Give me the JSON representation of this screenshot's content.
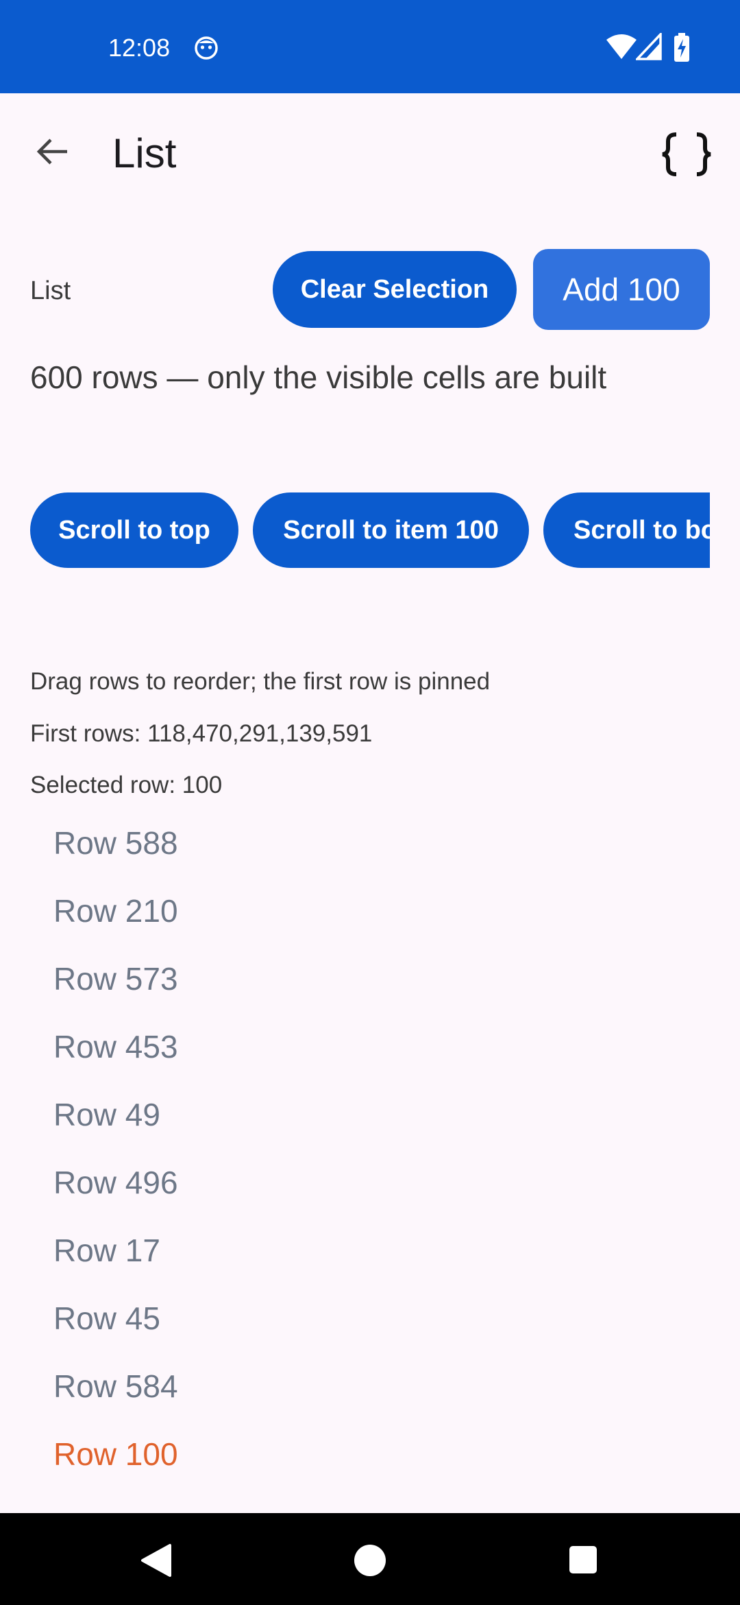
{
  "status_bar": {
    "time": "12:08",
    "bg_color": "#0B5BCE",
    "icons": [
      "smiley-icon",
      "wifi-icon",
      "signal-icon",
      "battery-charging-icon"
    ]
  },
  "app_bar": {
    "title": "List",
    "back_icon": "arrow-back-icon",
    "action_icon": "code-braces-icon"
  },
  "controls": {
    "label": "List",
    "clear_selection": "Clear Selection",
    "add_100": "Add 100"
  },
  "subtitle": "600 rows — only the visible cells are built",
  "scroll_buttons": {
    "top": "Scroll to top",
    "item_100": "Scroll to item 100",
    "bottom": "Scroll to bottom"
  },
  "hints": {
    "drag": "Drag rows to reorder; the first row is pinned",
    "first_rows": "First rows: 118,470,291,139,591",
    "selected": "Selected row: 100"
  },
  "rows": [
    "Row 588",
    "Row 210",
    "Row 573",
    "Row 453",
    "Row 49",
    "Row 496",
    "Row 17",
    "Row 45",
    "Row 584",
    "Row 100"
  ],
  "selected_row_index": 9,
  "colors": {
    "accent": "#0B5BCE",
    "add_button": "#3172DE",
    "row_text": "#6D7787",
    "selected_row": "#E0622C",
    "background": "#FDF7FC"
  },
  "nav_bar": {
    "icons": [
      "nav-back-icon",
      "nav-home-icon",
      "nav-recents-icon"
    ]
  }
}
